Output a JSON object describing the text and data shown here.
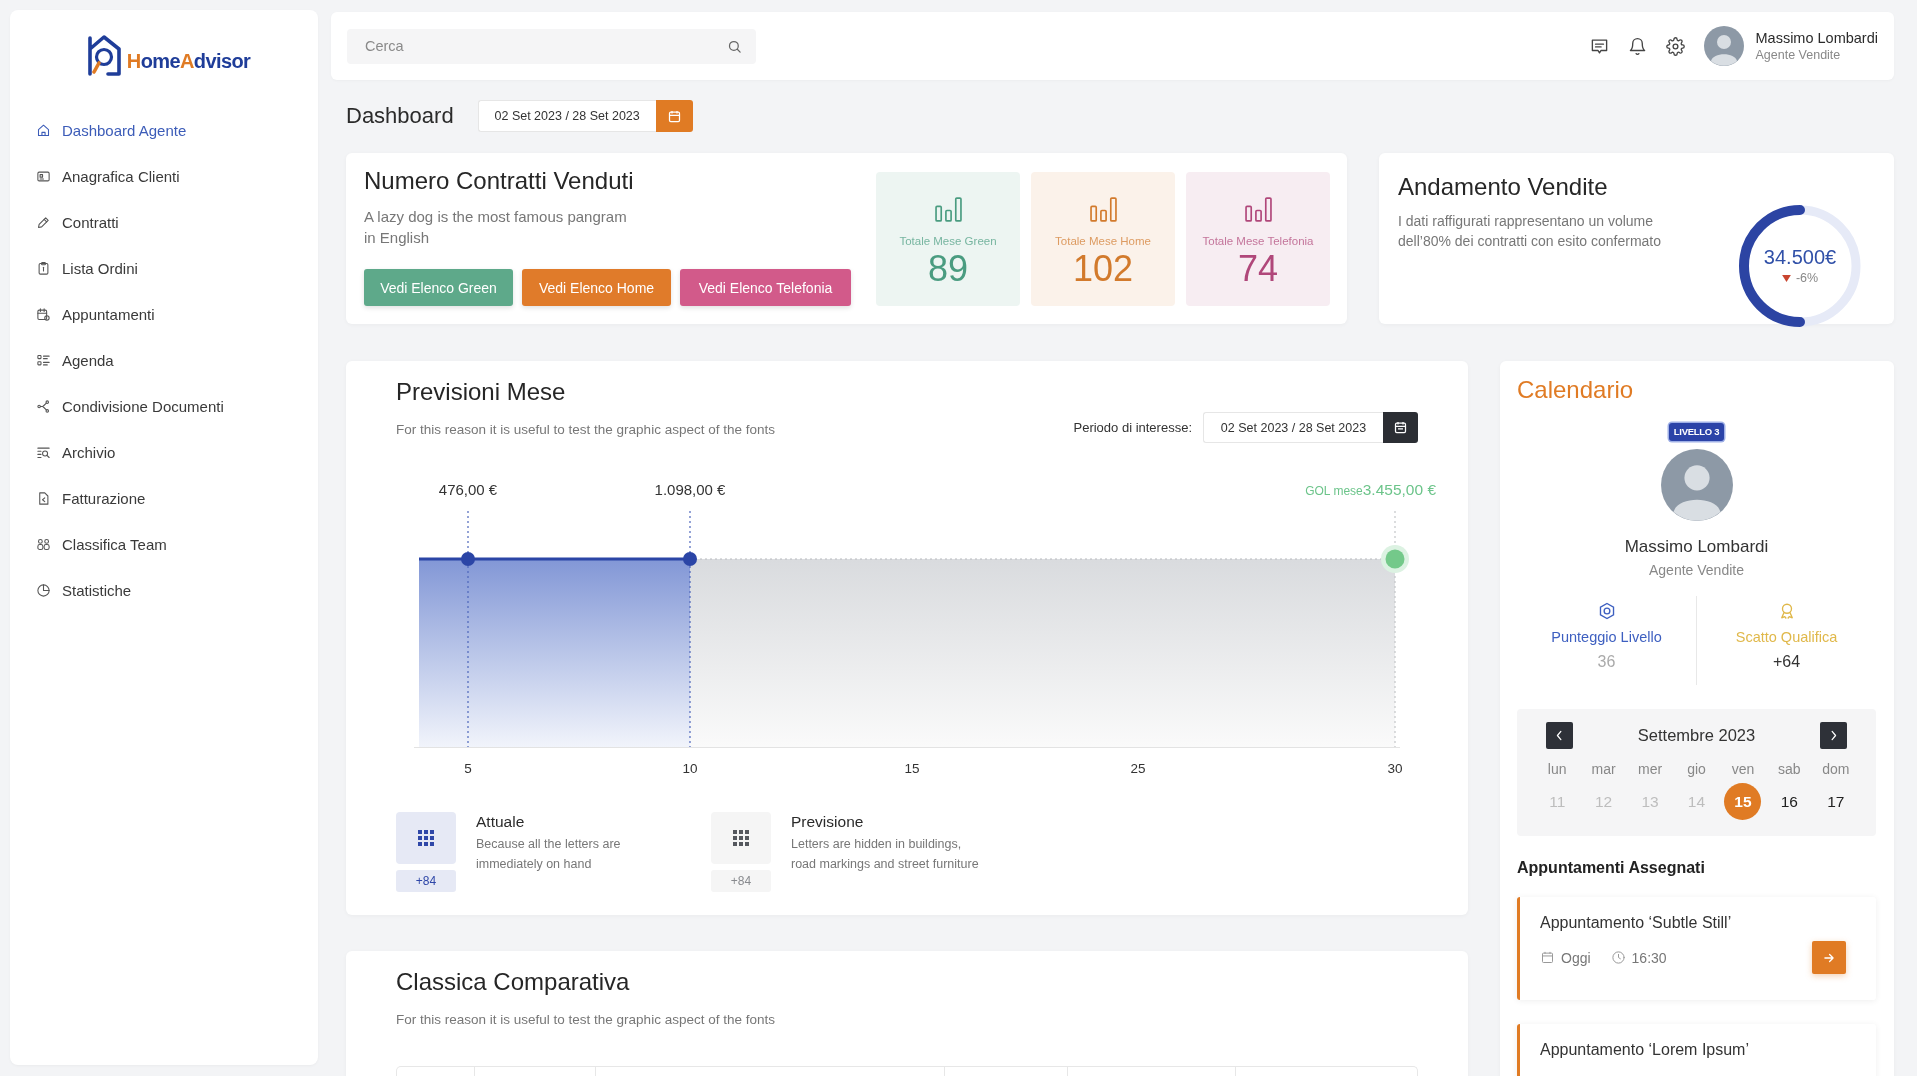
{
  "sidebar": {
    "logo": {
      "parts": [
        {
          "text": "H",
          "color": "#e07b24"
        },
        {
          "text": "ome",
          "color": "#1f3d99"
        },
        {
          "text": "A",
          "color": "#e07b24"
        },
        {
          "text": "dvisor",
          "color": "#1f3d99"
        }
      ]
    },
    "items": [
      {
        "label": "Dashboard Agente",
        "selected": true
      },
      {
        "label": "Anagrafica Clienti",
        "selected": false
      },
      {
        "label": "Contratti",
        "selected": false
      },
      {
        "label": "Lista Ordini",
        "selected": false
      },
      {
        "label": "Appuntamenti",
        "selected": false
      },
      {
        "label": "Agenda",
        "selected": false
      },
      {
        "label": "Condivisione Documenti",
        "selected": false
      },
      {
        "label": "Archivio",
        "selected": false
      },
      {
        "label": "Fatturazione",
        "selected": false
      },
      {
        "label": "Classifica Team",
        "selected": false
      },
      {
        "label": "Statistiche",
        "selected": false
      }
    ]
  },
  "top_bar": {
    "search": {
      "placeholder": "Cerca"
    },
    "user": {
      "name": "Massimo Lombardi",
      "role": "Agente Vendite"
    }
  },
  "page_header": {
    "title": "Dashboard",
    "date_range": "02 Set 2023 / 28 Set 2023"
  },
  "contracts_card": {
    "title": "Numero Contratti Venduti",
    "description": "A lazy dog is the most famous pangram in English",
    "buttons": [
      {
        "label": "Vedi Elenco Green",
        "color": "#5ea98a"
      },
      {
        "label": "Vedi Elenco Home",
        "color": "#e07b2a"
      },
      {
        "label": "Vedi Elenco Telefonia",
        "color": "#d25a8a"
      }
    ],
    "tiles": [
      {
        "label": "Totale Mese Green",
        "value": "89",
        "color": "#4a9c80"
      },
      {
        "label": "Totale Mese Home",
        "value": "102",
        "color": "#d27a2c"
      },
      {
        "label": "Totale Mese Telefonia",
        "value": "74",
        "color": "#b0477a"
      }
    ]
  },
  "sales_trend": {
    "title": "Andamento Vendite",
    "description": "I dati raffigurati rappresentano un volume dell’80% dei contratti con esito confermato",
    "gauge": {
      "value": "34.500€",
      "change": "-6%",
      "falling": true,
      "level": 0.5
    }
  },
  "monthly_forecast": {
    "title": "Previsioni Mese",
    "subtitle": "For this reason it is useful to test the graphic aspect of the fonts",
    "period": {
      "label": "Periodo di interesse:",
      "date_range": "02 Set 2023 / 28 Set 2023"
    },
    "chart": {
      "x_labels": [
        "5",
        "10",
        "15",
        "25",
        "30"
      ],
      "markers": [
        {
          "label": "476,00 €"
        },
        {
          "label": "1.098,00 €"
        }
      ],
      "goal": {
        "label": "GOL mese",
        "value": "3.455,00 €"
      }
    },
    "legend": [
      {
        "title": "Attuale",
        "description": "Because all the letters are immediately on hand",
        "badge": "+84",
        "color": "#2f47a8"
      },
      {
        "title": "Previsione",
        "description": "Letters are hidden in buildings, road markings and street furniture",
        "badge": "+84",
        "color": "#55585e"
      }
    ]
  },
  "comparative_ranking": {
    "title": "Classica Comparativa",
    "subtitle": "For this reason it is useful to test the graphic aspect of the fonts"
  },
  "calendar_panel": {
    "title": "Calendario",
    "profile": {
      "level_badge": "LIVELLO 3",
      "name": "Massimo Lombardi",
      "role": "Agente Vendite"
    },
    "stats": [
      {
        "label": "Punteggio Livello",
        "value": "36",
        "color": "#3d5fc0",
        "muted": true
      },
      {
        "label": "Scatto Qualifica",
        "value": "+64",
        "color": "#e0b84a",
        "muted": false
      }
    ],
    "month": {
      "title": "Settembre 2023",
      "weekdays": [
        "lun",
        "mar",
        "mer",
        "gio",
        "ven",
        "sab",
        "dom"
      ],
      "days": [
        {
          "label": "11",
          "disabled": true,
          "selected": false
        },
        {
          "label": "12",
          "disabled": true,
          "selected": false
        },
        {
          "label": "13",
          "disabled": true,
          "selected": false
        },
        {
          "label": "14",
          "disabled": true,
          "selected": false
        },
        {
          "label": "15",
          "disabled": false,
          "selected": true
        },
        {
          "label": "16",
          "disabled": false,
          "selected": false
        },
        {
          "label": "17",
          "disabled": false,
          "selected": false
        }
      ]
    },
    "appointments": {
      "title": "Appuntamenti Assegnati",
      "items": [
        {
          "title": "Appuntamento ‘Subtle Still’",
          "date": "Oggi",
          "time": "16:30"
        },
        {
          "title": "Appuntamento ‘Lorem Ipsum’"
        }
      ]
    }
  }
}
